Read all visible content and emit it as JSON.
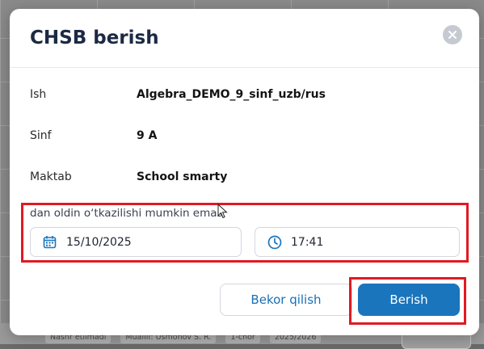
{
  "background": {
    "tags": [
      "Nashr etilmadi",
      "Muallif: Usmonov S. R.",
      "1-chor",
      "2025/2026"
    ]
  },
  "modal": {
    "title": "CHSB berish",
    "close_icon": "close-icon",
    "fields": [
      {
        "label": "Ish",
        "value": "Algebra_DEMO_9_sinf_uzb/rus"
      },
      {
        "label": "Sinf",
        "value": "9 A"
      },
      {
        "label": "Maktab",
        "value": "School smarty"
      }
    ],
    "deadline_hint": "dan oldin oʻtkazilishi mumkin emas",
    "date_value": "15/10/2025",
    "time_value": "17:41",
    "cancel_label": "Bekor qilish",
    "submit_label": "Berish"
  },
  "colors": {
    "accent": "#1a75bd",
    "title": "#1c2a44",
    "highlight": "#e01a22"
  }
}
